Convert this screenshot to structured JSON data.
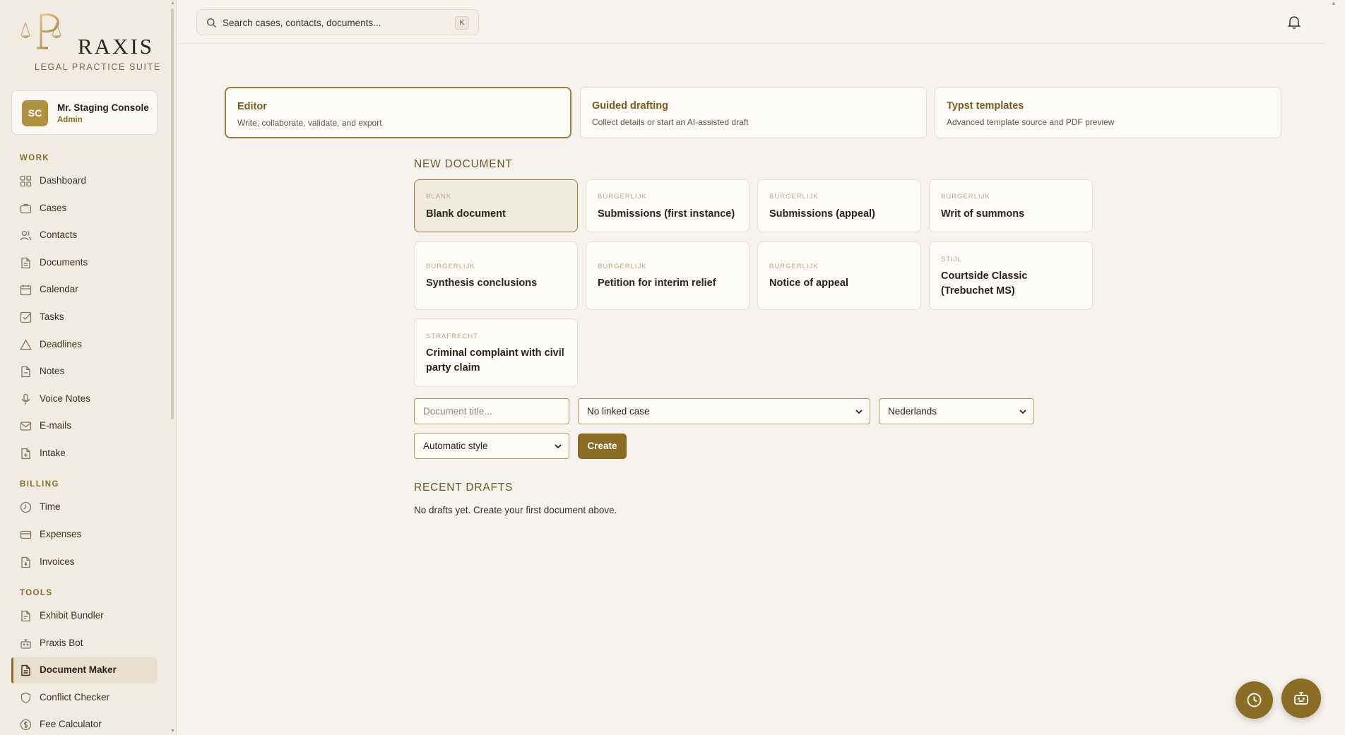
{
  "brand": {
    "name": "RAXIS",
    "subtitle": "LEGAL PRACTICE SUITE"
  },
  "user": {
    "initials": "SC",
    "name": "Mr. Staging Console",
    "role": "Admin"
  },
  "sidebar": {
    "sections": [
      {
        "label": "WORK",
        "items": [
          {
            "label": "Dashboard",
            "icon": "dashboard-icon"
          },
          {
            "label": "Cases",
            "icon": "briefcase-icon"
          },
          {
            "label": "Contacts",
            "icon": "contacts-icon"
          },
          {
            "label": "Documents",
            "icon": "document-icon"
          },
          {
            "label": "Calendar",
            "icon": "calendar-icon"
          },
          {
            "label": "Tasks",
            "icon": "task-check-icon"
          },
          {
            "label": "Deadlines",
            "icon": "warning-triangle-icon"
          },
          {
            "label": "Notes",
            "icon": "note-icon"
          },
          {
            "label": "Voice Notes",
            "icon": "microphone-icon"
          },
          {
            "label": "E-mails",
            "icon": "mail-icon"
          },
          {
            "label": "Intake",
            "icon": "intake-icon"
          }
        ]
      },
      {
        "label": "BILLING",
        "items": [
          {
            "label": "Time",
            "icon": "clock-icon"
          },
          {
            "label": "Expenses",
            "icon": "credit-card-icon"
          },
          {
            "label": "Invoices",
            "icon": "invoice-icon"
          }
        ]
      },
      {
        "label": "TOOLS",
        "items": [
          {
            "label": "Exhibit Bundler",
            "icon": "bundle-icon"
          },
          {
            "label": "Praxis Bot",
            "icon": "bot-icon"
          },
          {
            "label": "Document Maker",
            "icon": "document-maker-icon",
            "active": true
          },
          {
            "label": "Conflict Checker",
            "icon": "shield-icon"
          },
          {
            "label": "Fee Calculator",
            "icon": "calculator-icon"
          }
        ]
      }
    ]
  },
  "search": {
    "placeholder": "Search cases, contacts, documents...",
    "shortcut": "K"
  },
  "modes": [
    {
      "title": "Editor",
      "subtitle": "Write, collaborate, validate, and export",
      "active": true
    },
    {
      "title": "Guided drafting",
      "subtitle": "Collect details or start an AI-assisted draft"
    },
    {
      "title": "Typst templates",
      "subtitle": "Advanced template source and PDF preview"
    }
  ],
  "new_document": {
    "heading": "NEW DOCUMENT",
    "templates": [
      {
        "category": "BLANK",
        "name": "Blank document",
        "active": true
      },
      {
        "category": "BURGERLIJK",
        "name": "Submissions (first instance)"
      },
      {
        "category": "BURGERLIJK",
        "name": "Submissions (appeal)"
      },
      {
        "category": "BURGERLIJK",
        "name": "Writ of summons"
      },
      {
        "category": "BURGERLIJK",
        "name": "Synthesis conclusions"
      },
      {
        "category": "BURGERLIJK",
        "name": "Petition for interim relief"
      },
      {
        "category": "BURGERLIJK",
        "name": "Notice of appeal"
      },
      {
        "category": "STIJL",
        "name": "Courtside Classic (Trebuchet MS)"
      },
      {
        "category": "STRAFRECHT",
        "name": "Criminal complaint with civil party claim"
      }
    ],
    "title_placeholder": "Document title...",
    "case_select": "No linked case",
    "language_select": "Nederlands",
    "style_select": "Automatic style",
    "create_label": "Create"
  },
  "recent_drafts": {
    "heading": "RECENT DRAFTS",
    "empty_text": "No drafts yet. Create your first document above."
  },
  "colors": {
    "accent": "#8a6d25",
    "background": "#f6f3ee",
    "sidebar": "#f1ece3"
  }
}
